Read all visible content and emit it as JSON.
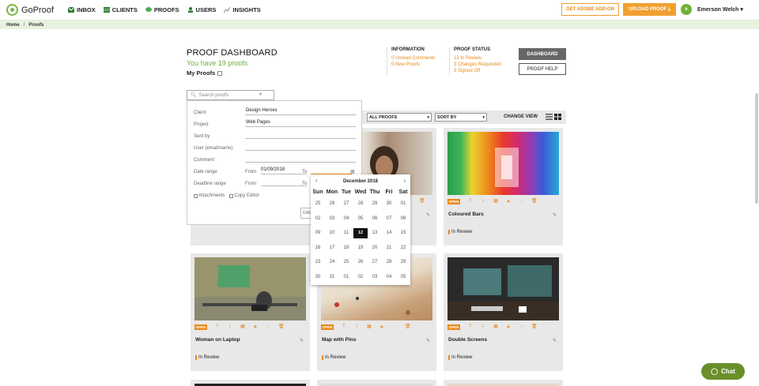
{
  "app": {
    "name": "GoProof"
  },
  "nav": [
    {
      "label": "INBOX",
      "icon": "inbox-icon"
    },
    {
      "label": "CLIENTS",
      "icon": "clients-icon"
    },
    {
      "label": "PROOFS",
      "icon": "proofs-icon"
    },
    {
      "label": "USERS",
      "icon": "users-icon"
    },
    {
      "label": "INSIGHTS",
      "icon": "insights-icon"
    }
  ],
  "header": {
    "addon_label": "GET ADOBE ADD-ON",
    "upload_label": "UPLOAD PROOF",
    "avatar_initial": "e",
    "user_name": "Emerson Welch"
  },
  "breadcrumb": [
    "Home",
    "Proofs"
  ],
  "dashboard": {
    "title": "PROOF DASHBOARD",
    "subtitle": "You have 19 proofs",
    "my_proofs_label": "My Proofs"
  },
  "information": {
    "heading": "INFORMATION",
    "items": [
      "0 Unread Comments",
      "0 New Proofs"
    ]
  },
  "proof_status": {
    "heading": "PROOF STATUS",
    "items": [
      "13 In Review",
      "3 Changes Requested",
      "3 Signed Off"
    ]
  },
  "buttons": {
    "dashboard": "DASHBOARD",
    "help": "PROOF HELP"
  },
  "search": {
    "placeholder": "Search proofs"
  },
  "filters": {
    "client": {
      "label": "Client",
      "value": "Design Heroes"
    },
    "project": {
      "label": "Project",
      "value": "Web Pages"
    },
    "sent_by": {
      "label": "Sent by",
      "value": ""
    },
    "user": {
      "label": "User (email/name)",
      "value": ""
    },
    "comment": {
      "label": "Comment",
      "value": ""
    },
    "date_range": {
      "label": "Date range",
      "from_label": "From",
      "from_value": "01/09/2018",
      "to_label": "To",
      "to_value": ""
    },
    "deadline_range": {
      "label": "Deadline range",
      "from_label": "From",
      "from_value": "",
      "to_label": "To",
      "to_value": ""
    },
    "attachments_label": "Attachments",
    "copy_editor_label": "Copy Editor",
    "cancel_partial": "CAN"
  },
  "toolbar": {
    "all_proofs": "ALL PROOFS",
    "sort_by": "SORT BY",
    "change_view": "CHANGE VIEW"
  },
  "calendar": {
    "month": "December 2018",
    "dow": [
      "Sun",
      "Mon",
      "Tue",
      "Wed",
      "Thu",
      "Fri",
      "Sat"
    ],
    "weeks": [
      [
        "25",
        "26",
        "27",
        "28",
        "29",
        "30",
        "01"
      ],
      [
        "02",
        "03",
        "04",
        "05",
        "06",
        "07",
        "08"
      ],
      [
        "09",
        "10",
        "11",
        "12",
        "13",
        "14",
        "15"
      ],
      [
        "16",
        "17",
        "18",
        "19",
        "20",
        "21",
        "22"
      ],
      [
        "23",
        "24",
        "25",
        "26",
        "27",
        "28",
        "29"
      ],
      [
        "30",
        "31",
        "01",
        "02",
        "03",
        "04",
        "05"
      ]
    ],
    "selected": "12"
  },
  "cards": [
    {
      "name": "",
      "status": ""
    },
    {
      "name": "",
      "status": ""
    },
    {
      "name": "Coloured Bars",
      "status": "In Review"
    },
    {
      "name": "Woman on Laptop",
      "status": "In Review"
    },
    {
      "name": "Map with Pins",
      "status": "In Review"
    },
    {
      "name": "Double Screens",
      "status": "In Review"
    }
  ],
  "card_open_label": "OPEN",
  "chat": {
    "label": "Chat"
  }
}
